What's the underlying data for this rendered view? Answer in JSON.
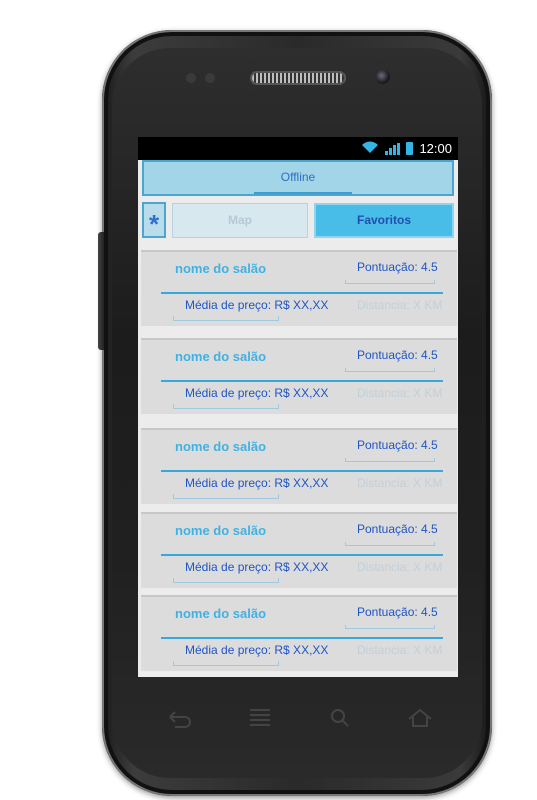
{
  "status_bar": {
    "time": "12:00"
  },
  "app_bar": {
    "title": "Offline"
  },
  "tabs": {
    "star": "*",
    "map": "Map",
    "favoritos": "Favoritos"
  },
  "salons": [
    {
      "name": "nome do salão",
      "score": "Pontuação: 4.5",
      "price": "Média de preço: R$ XX,XX",
      "distance": "Distancia: X KM"
    },
    {
      "name": "nome do salão",
      "score": "Pontuação: 4.5",
      "price": "Média de preço: R$ XX,XX",
      "distance": "Distancia: X KM"
    },
    {
      "name": "nome do salão",
      "score": "Pontuação: 4.5",
      "price": "Média de preço: R$ XX,XX",
      "distance": "Distancia: X KM"
    },
    {
      "name": "nome do salão",
      "score": "Pontuação: 4.5",
      "price": "Média de preço: R$ XX,XX",
      "distance": "Distancia: X KM"
    },
    {
      "name": "nome do salão",
      "score": "Pontuação: 4.5",
      "price": "Média de preço: R$ XX,XX",
      "distance": "Distancia: X KM"
    }
  ],
  "icons": {
    "wifi": "wifi-icon",
    "signal": "signal-icon",
    "battery": "battery-icon",
    "back": "back-icon",
    "menu": "menu-icon",
    "search": "search-icon",
    "home": "home-icon"
  },
  "colors": {
    "accent": "#35b5e5",
    "app_bar_bg": "#a3d5e8",
    "active_tab": "#48bde7",
    "name_text": "#3fb2e3",
    "body_text": "#1f55c4"
  }
}
